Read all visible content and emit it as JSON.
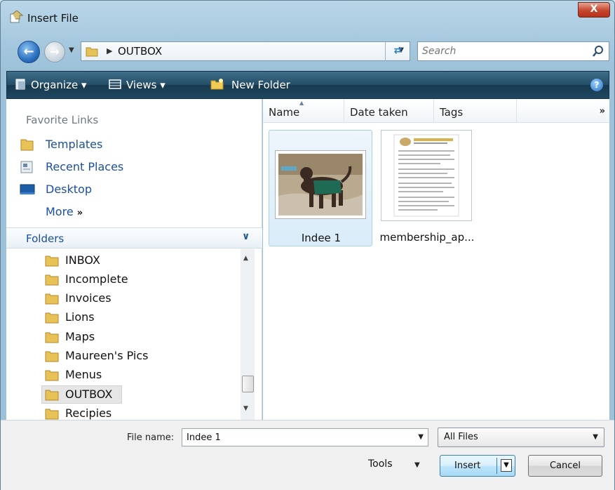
{
  "window": {
    "title": "Insert File",
    "close_label": "X"
  },
  "address": {
    "path": "OUTBOX",
    "search_placeholder": "Search"
  },
  "toolbar": {
    "organize": "Organize",
    "views": "Views",
    "new_folder": "New Folder"
  },
  "favorites": {
    "title": "Favorite Links",
    "links": [
      "Templates",
      "Recent Places",
      "Desktop"
    ],
    "more": "More"
  },
  "folders": {
    "title": "Folders",
    "items": [
      "INBOX",
      "Incomplete",
      "Invoices",
      "Lions",
      "Maps",
      "Maureen's Pics",
      "Menus",
      "OUTBOX",
      "Recipies"
    ],
    "selected": "OUTBOX"
  },
  "columns": [
    "Name",
    "Date taken",
    "Tags"
  ],
  "files": [
    {
      "name": "Indee 1",
      "selected": true
    },
    {
      "name": "membership_ap...",
      "selected": false
    }
  ],
  "bottom": {
    "file_name_label": "File name:",
    "file_name_value": "Indee 1",
    "file_type": "All Files",
    "tools": "Tools",
    "insert": "Insert",
    "cancel": "Cancel"
  },
  "colors": {
    "toolbar": "#234d66",
    "link": "#1c4fa1",
    "selection": "#d9ecf9"
  }
}
